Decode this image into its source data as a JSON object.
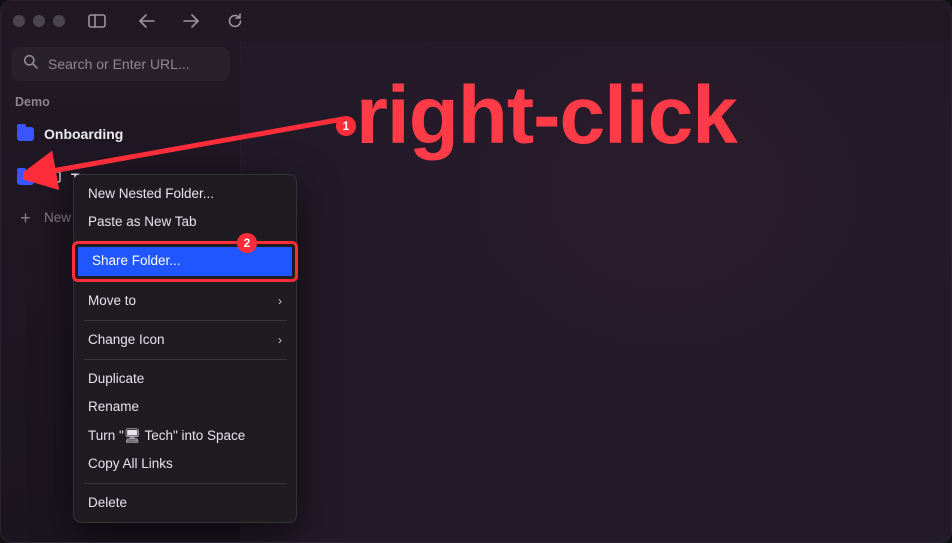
{
  "titlebar": {
    "sidebar_toggle_icon": "sidebar-toggle",
    "nav_back_icon": "arrow-left",
    "nav_forward_icon": "arrow-right",
    "reload_icon": "reload"
  },
  "search": {
    "placeholder": "Search or Enter URL..."
  },
  "sidebar": {
    "space_label": "Demo",
    "items": [
      {
        "kind": "folder",
        "label": "Onboarding"
      },
      {
        "kind": "folder-monitor",
        "label": "T"
      }
    ],
    "new_folder_label": "New Folder"
  },
  "context_menu": {
    "groups": [
      [
        {
          "label": "New Nested Folder...",
          "submenu": false
        },
        {
          "label": "Paste as New Tab",
          "submenu": false
        }
      ],
      [
        {
          "label": "Share Folder...",
          "submenu": false,
          "highlight": true
        }
      ],
      [
        {
          "label": "Move to",
          "submenu": true
        }
      ],
      [
        {
          "label": "Change Icon",
          "submenu": true
        }
      ],
      [
        {
          "label": "Duplicate",
          "submenu": false
        },
        {
          "label": "Rename",
          "submenu": false
        },
        {
          "label": "Turn \"🖥 Tech\" into Space",
          "submenu": false
        },
        {
          "label": "Copy All Links",
          "submenu": false
        }
      ],
      [
        {
          "label": "Delete",
          "submenu": false
        }
      ]
    ]
  },
  "annotations": {
    "title": "right-click",
    "badge1": "1",
    "badge2": "2",
    "accent_color": "#ff2d3a"
  }
}
